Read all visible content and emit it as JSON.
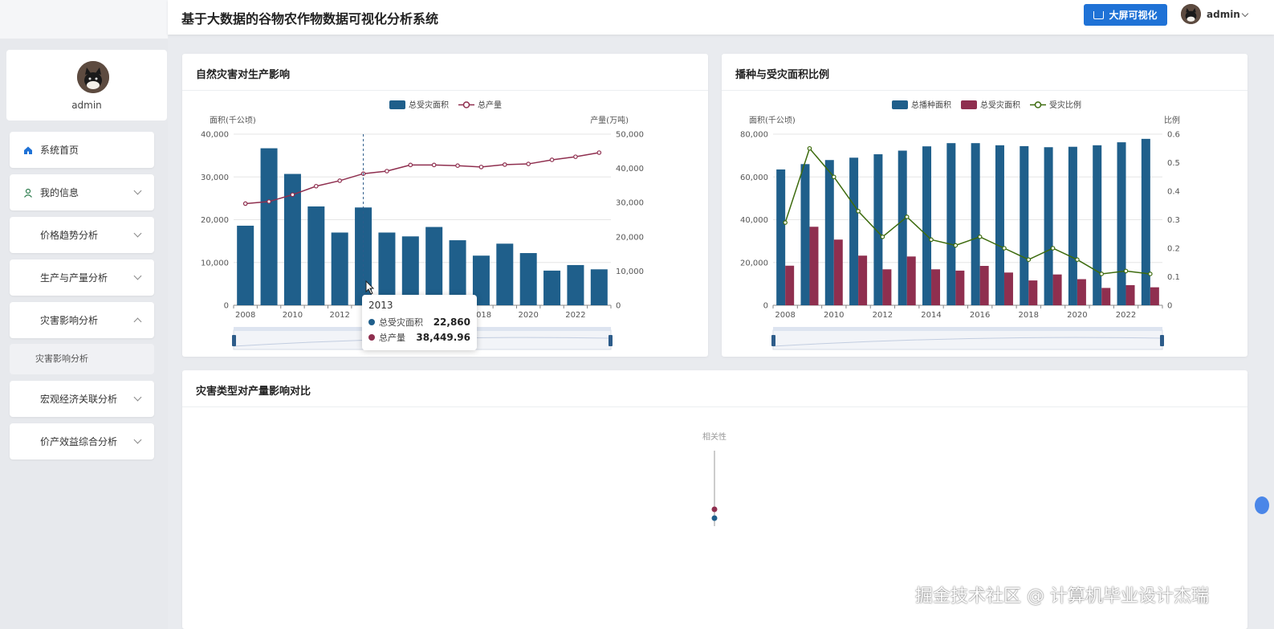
{
  "header": {
    "title": "基于大数据的谷物农作物数据可视化分析系统",
    "bigscreen_label": "大屏可视化",
    "username": "admin"
  },
  "sidebar": {
    "username": "admin",
    "items": [
      {
        "label": "系统首页",
        "icon": "home-icon"
      },
      {
        "label": "我的信息",
        "icon": "user-icon"
      },
      {
        "label": "价格趋势分析",
        "icon": "grid-icon"
      },
      {
        "label": "生产与产量分析",
        "icon": "grid-icon"
      },
      {
        "label": "灾害影响分析",
        "icon": "grid-icon",
        "expanded": true
      },
      {
        "label": "宏观经济关联分析",
        "icon": "grid-icon"
      },
      {
        "label": "价产效益综合分析",
        "icon": "grid-icon"
      }
    ],
    "submenu": {
      "label": "灾害影响分析"
    }
  },
  "cards": {
    "chart1_title": "自然灾害对生产影响",
    "chart2_title": "播种与受灾面积比例",
    "chart3_title": "灾害类型对产量影响对比"
  },
  "tooltip": {
    "year": "2013",
    "rows": [
      {
        "label": "总受灾面积",
        "value": "22,860"
      },
      {
        "label": "总产量",
        "value": "38,449.96"
      }
    ]
  },
  "watermark": "掘金技术社区 @ 计算机毕业设计杰瑞",
  "colors": {
    "bar_blue": "#1f5f8b",
    "line_red": "#8f2f4f",
    "line_green": "#3d6b0e",
    "accent": "#1f72d6"
  },
  "chart_data": [
    {
      "type": "bar",
      "legend": [
        "总受灾面积",
        "总产量"
      ],
      "ylabel": "面积(千公顷)",
      "y2label": "产量(万吨)",
      "x": [
        2008,
        2009,
        2010,
        2011,
        2012,
        2013,
        2014,
        2015,
        2016,
        2017,
        2018,
        2019,
        2020,
        2021,
        2022,
        2023
      ],
      "xticks": [
        "2008",
        "2010",
        "2012",
        "2014",
        "2016",
        "2018",
        "2020",
        "2022"
      ],
      "yticks": [
        "0",
        "10,000",
        "20,000",
        "30,000",
        "40,000"
      ],
      "y2ticks": [
        "0",
        "10,000",
        "20,000",
        "30,000",
        "40,000",
        "50,000"
      ],
      "ylim": [
        0,
        40000
      ],
      "y2lim": [
        0,
        50000
      ],
      "series": [
        {
          "name": "总受灾面积",
          "kind": "bar",
          "axis": "left",
          "values": [
            18600,
            36700,
            30700,
            23100,
            17000,
            22860,
            17000,
            16100,
            18300,
            15200,
            11600,
            14400,
            12200,
            8100,
            9400,
            8400
          ]
        },
        {
          "name": "总产量",
          "kind": "line",
          "axis": "right",
          "values": [
            29700,
            30300,
            32300,
            34800,
            36400,
            38450,
            39200,
            41000,
            41000,
            40800,
            40400,
            41100,
            41300,
            42500,
            43400,
            44600
          ]
        }
      ]
    },
    {
      "type": "bar",
      "legend": [
        "总播种面积",
        "总受灾面积",
        "受灾比例"
      ],
      "ylabel": "面积(千公顷)",
      "y2label": "比例",
      "x": [
        2008,
        2009,
        2010,
        2011,
        2012,
        2013,
        2014,
        2015,
        2016,
        2017,
        2018,
        2019,
        2020,
        2021,
        2022,
        2023
      ],
      "xticks": [
        "2008",
        "2010",
        "2012",
        "2014",
        "2016",
        "2018",
        "2020",
        "2022"
      ],
      "yticks": [
        "0",
        "20,000",
        "40,000",
        "60,000",
        "80,000"
      ],
      "y2ticks": [
        "0",
        "0.1",
        "0.2",
        "0.3",
        "0.4",
        "0.5",
        "0.6"
      ],
      "ylim": [
        0,
        80000
      ],
      "y2lim": [
        0,
        0.6
      ],
      "series": [
        {
          "name": "总播种面积",
          "kind": "bar",
          "axis": "left",
          "values": [
            63500,
            66000,
            67900,
            69000,
            70600,
            72300,
            74300,
            75800,
            75800,
            74800,
            74400,
            73900,
            74100,
            74800,
            76200,
            77800
          ]
        },
        {
          "name": "总受灾面积",
          "kind": "bar",
          "axis": "left",
          "values": [
            18500,
            36700,
            30700,
            23200,
            16800,
            22800,
            16800,
            16200,
            18400,
            15300,
            11600,
            14400,
            12200,
            8100,
            9400,
            8400
          ]
        },
        {
          "name": "受灾比例",
          "kind": "line",
          "axis": "right",
          "values": [
            0.29,
            0.55,
            0.45,
            0.33,
            0.24,
            0.31,
            0.23,
            0.21,
            0.24,
            0.2,
            0.16,
            0.2,
            0.16,
            0.11,
            0.12,
            0.11
          ]
        }
      ]
    },
    {
      "type": "scatter",
      "label": "相关性",
      "series": [
        {
          "name": "",
          "values": [
            0
          ]
        },
        {
          "name": "",
          "values": [
            0
          ]
        }
      ]
    }
  ]
}
